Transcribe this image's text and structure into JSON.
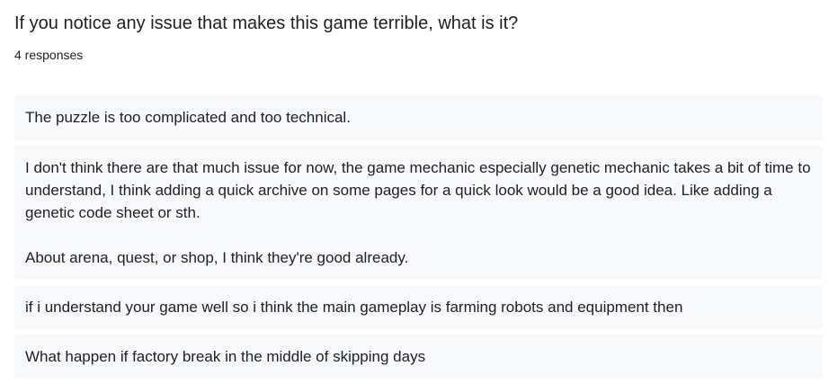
{
  "question": {
    "title": "If you notice any issue that makes this game terrible, what is it?",
    "response_count": "4 responses"
  },
  "responses": [
    {
      "paragraphs": [
        "The puzzle is too complicated and too technical."
      ]
    },
    {
      "paragraphs": [
        "I don't think there are that much issue for now, the game mechanic especially genetic mechanic takes a bit of time to understand, I think adding a quick archive on some pages for a quick look would be a good idea. Like adding a genetic code sheet or sth.",
        "About arena, quest, or shop, I think they're good already."
      ]
    },
    {
      "paragraphs": [
        "if i understand your game well so i think the main gameplay is farming robots and equipment then"
      ]
    },
    {
      "paragraphs": [
        "What happen if factory break in the middle of skipping days"
      ]
    }
  ]
}
